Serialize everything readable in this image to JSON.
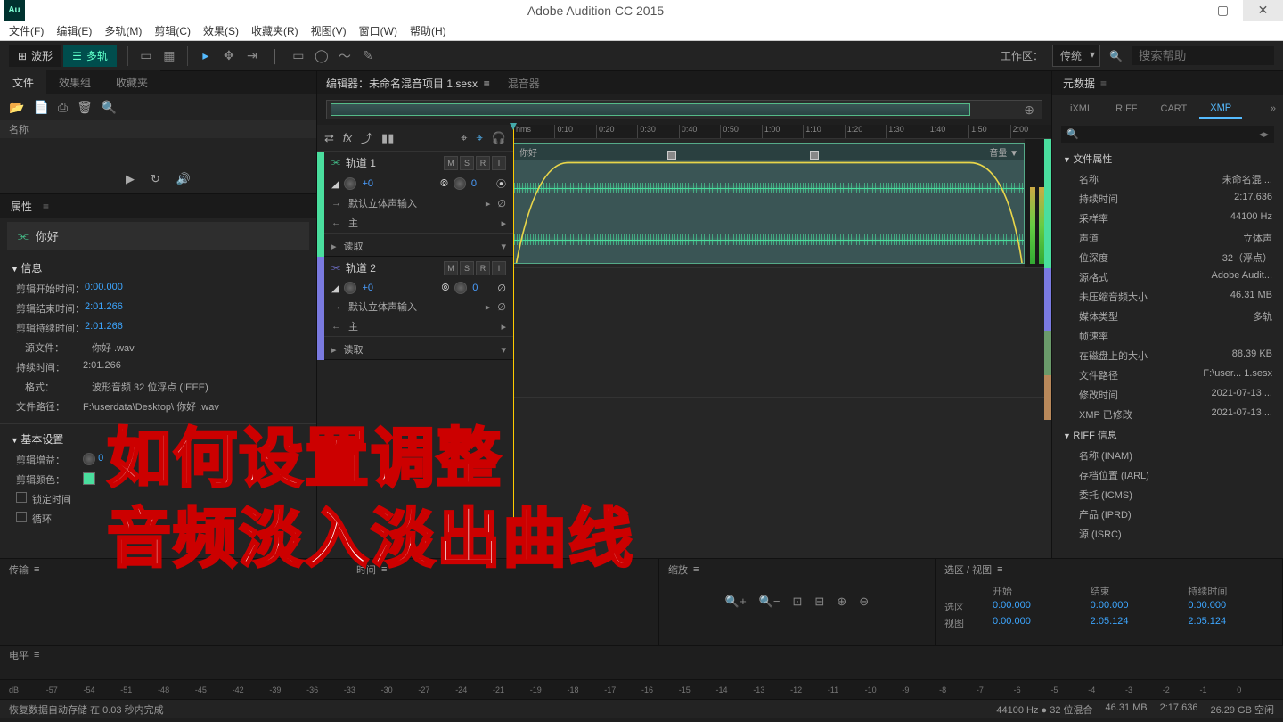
{
  "app": {
    "title": "Adobe Audition CC 2015",
    "icon": "Au"
  },
  "menu": [
    "文件(F)",
    "编辑(E)",
    "多轨(M)",
    "剪辑(C)",
    "效果(S)",
    "收藏夹(R)",
    "视图(V)",
    "窗口(W)",
    "帮助(H)"
  ],
  "viewTabs": {
    "waveform": "波形",
    "multitrack": "多轨"
  },
  "workspace": {
    "label": "工作区：",
    "value": "传统"
  },
  "search": {
    "placeholder": "搜索帮助"
  },
  "leftTabs": [
    "文件",
    "效果组",
    "收藏夹"
  ],
  "fileHeader": "名称",
  "propsHeader": "属性",
  "propsFile": "你好",
  "info": {
    "header": "信息",
    "rows": [
      {
        "k": "剪辑开始时间：",
        "v": "0:00.000"
      },
      {
        "k": "剪辑结束时间：",
        "v": "2:01.266"
      },
      {
        "k": "剪辑持续时间：",
        "v": "2:01.266"
      }
    ],
    "source": {
      "k": "源文件：",
      "v": "你好 .wav"
    },
    "duration": {
      "k": "持续时间：",
      "v": "2:01.266"
    },
    "format": {
      "k": "格式：",
      "v": "波形音频 32 位浮点 (IEEE)"
    },
    "path": {
      "k": "文件路径：",
      "v": "F:\\userdata\\Desktop\\ 你好 .wav"
    }
  },
  "basic": {
    "header": "基本设置",
    "gain": "剪辑增益：",
    "gainVal": "0",
    "color": "剪辑颜色：",
    "lock": "锁定时间",
    "loop": "循环"
  },
  "editor": {
    "tab1": "编辑器：未命名混音项目 1.sesx",
    "tab2": "混音器"
  },
  "ruler": [
    "hms",
    "0:10",
    "0:20",
    "0:30",
    "0:40",
    "0:50",
    "1:00",
    "1:10",
    "1:20",
    "1:30",
    "1:40",
    "1:50",
    "2:00"
  ],
  "tracks": {
    "t1": {
      "name": "轨道 1",
      "vol": "+0",
      "pan": "0",
      "input": "默认立体声输入",
      "output": "主",
      "read": "读取"
    },
    "t2": {
      "name": "轨道 2",
      "vol": "+0",
      "pan": "0",
      "input": "默认立体声输入",
      "output": "主",
      "read": "读取"
    }
  },
  "clip": {
    "name": "你好",
    "volLabel": "音量 ▼"
  },
  "metadata": {
    "header": "元数据",
    "tabs": [
      "iXML",
      "RIFF",
      "CART",
      "XMP"
    ],
    "group1": "文件属性",
    "rows1": [
      {
        "k": "名称",
        "v": "未命名混 ..."
      },
      {
        "k": "持续时间",
        "v": "2:17.636"
      },
      {
        "k": "采样率",
        "v": "44100 Hz"
      },
      {
        "k": "声道",
        "v": "立体声"
      },
      {
        "k": "位深度",
        "v": "32（浮点）"
      },
      {
        "k": "源格式",
        "v": "Adobe Audit..."
      },
      {
        "k": "未压缩音频大小",
        "v": "46.31 MB"
      },
      {
        "k": "媒体类型",
        "v": "多轨"
      },
      {
        "k": "帧速率",
        "v": ""
      },
      {
        "k": "在磁盘上的大小",
        "v": "88.39 KB"
      },
      {
        "k": "文件路径",
        "v": "F:\\user... 1.sesx"
      },
      {
        "k": "修改时间",
        "v": "2021-07-13 ..."
      },
      {
        "k": "XMP 已修改",
        "v": "2021-07-13 ..."
      }
    ],
    "group2": "RIFF 信息",
    "rows2": [
      "名称 (INAM)",
      "存档位置 (IARL)",
      "委托 (ICMS)",
      "产品 (IPRD)",
      "源 (ISRC)"
    ]
  },
  "bottom": {
    "transport": "传输",
    "time": "时间",
    "zoom": "缩放",
    "sel": "选区 / 视图",
    "selHeaders": [
      "",
      "开始",
      "结束",
      "持续时间"
    ],
    "selRows": [
      {
        "k": "选区",
        "a": "0:00.000",
        "b": "0:00.000",
        "c": "0:00.000"
      },
      {
        "k": "视图",
        "a": "0:00.000",
        "b": "2:05.124",
        "c": "2:05.124"
      }
    ]
  },
  "levels": "电平",
  "db": [
    "dB",
    "-57",
    "-54",
    "-51",
    "-48",
    "-45",
    "-42",
    "-39",
    "-36",
    "-33",
    "-30",
    "-27",
    "-24",
    "-21",
    "-19",
    "-18",
    "-17",
    "-16",
    "-15",
    "-14",
    "-13",
    "-12",
    "-11",
    "-10",
    "-9",
    "-8",
    "-7",
    "-6",
    "-5",
    "-4",
    "-3",
    "-2",
    "-1",
    "0"
  ],
  "status": {
    "left": "恢复数据自动存储 在 0.03 秒内完成",
    "right": [
      "44100 Hz ● 32 位混合",
      "46.31 MB",
      "2:17.636",
      "26.29 GB 空闲"
    ]
  },
  "overlay": {
    "line1": "如何设置调整",
    "line2": "音频淡入淡出曲线"
  }
}
